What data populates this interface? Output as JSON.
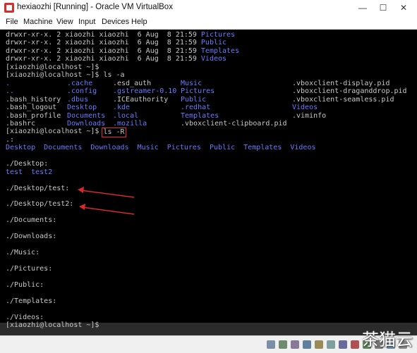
{
  "window": {
    "title": "hexiaozhi [Running] - Oracle VM VirtualBox",
    "controls": {
      "minimize": "—",
      "maximize": "☐",
      "close": "✕"
    }
  },
  "menu": [
    {
      "label": "File"
    },
    {
      "label": "Machine"
    },
    {
      "label": "View"
    },
    {
      "label": "Input"
    },
    {
      "label": "Devices"
    },
    {
      "label": "Help"
    }
  ],
  "terminal": {
    "lines": [
      {
        "cols": [
          {
            "text": "drwxr-xr-x. 2 xiaozhi xiaozhi  6 Aug  8 21:59 ",
            "color": "grey"
          },
          {
            "text": "Pictures",
            "color": "blue"
          }
        ]
      },
      {
        "cols": [
          {
            "text": "drwxr-xr-x. 2 xiaozhi xiaozhi  6 Aug  8 21:59 ",
            "color": "grey"
          },
          {
            "text": "Public",
            "color": "blue"
          }
        ]
      },
      {
        "cols": [
          {
            "text": "drwxr-xr-x. 2 xiaozhi xiaozhi  6 Aug  8 21:59 ",
            "color": "grey"
          },
          {
            "text": "Templates",
            "color": "blue"
          }
        ]
      },
      {
        "cols": [
          {
            "text": "drwxr-xr-x. 2 xiaozhi xiaozhi  6 Aug  8 21:59 ",
            "color": "grey"
          },
          {
            "text": "Videos",
            "color": "blue"
          }
        ]
      },
      {
        "cols": [
          {
            "text": "[xiaozhi@localhost ~]$",
            "color": "grey"
          }
        ]
      },
      {
        "cols": [
          {
            "text": "[xiaozhi@localhost ~]$ ls -a",
            "color": "grey"
          }
        ]
      },
      {
        "cols": [
          {
            "text": ".",
            "color": "blue",
            "col": 0
          },
          {
            "text": ".cache",
            "color": "blue",
            "col": 1
          },
          {
            "text": ".esd_auth",
            "color": "grey",
            "col": 2
          },
          {
            "text": "Music",
            "color": "blue",
            "col": 3
          },
          {
            "text": ".vboxclient-display.pid",
            "color": "grey",
            "col": 4
          }
        ]
      },
      {
        "cols": [
          {
            "text": "..",
            "color": "blue",
            "col": 0
          },
          {
            "text": ".config",
            "color": "blue",
            "col": 1
          },
          {
            "text": ".gstreamer-0.10",
            "color": "blue",
            "col": 2
          },
          {
            "text": "Pictures",
            "color": "blue",
            "col": 3
          },
          {
            "text": ".vboxclient-draganddrop.pid",
            "color": "grey",
            "col": 4
          }
        ]
      },
      {
        "cols": [
          {
            "text": ".bash_history",
            "color": "grey",
            "col": 0
          },
          {
            "text": ".dbus",
            "color": "blue",
            "col": 1
          },
          {
            "text": ".ICEauthority",
            "color": "grey",
            "col": 2
          },
          {
            "text": "Public",
            "color": "blue",
            "col": 3
          },
          {
            "text": ".vboxclient-seamless.pid",
            "color": "grey",
            "col": 4
          }
        ]
      },
      {
        "cols": [
          {
            "text": ".bash_logout",
            "color": "grey",
            "col": 0
          },
          {
            "text": "Desktop",
            "color": "blue",
            "col": 1
          },
          {
            "text": ".kde",
            "color": "blue",
            "col": 2
          },
          {
            "text": ".redhat",
            "color": "blue",
            "col": 3
          },
          {
            "text": "Videos",
            "color": "blue",
            "col": 4
          }
        ]
      },
      {
        "cols": [
          {
            "text": ".bash_profile",
            "color": "grey",
            "col": 0
          },
          {
            "text": "Documents",
            "color": "blue",
            "col": 1
          },
          {
            "text": ".local",
            "color": "blue",
            "col": 2
          },
          {
            "text": "Templates",
            "color": "blue",
            "col": 3
          },
          {
            "text": ".viminfo",
            "color": "grey",
            "col": 4
          }
        ]
      },
      {
        "cols": [
          {
            "text": ".bashrc",
            "color": "grey",
            "col": 0
          },
          {
            "text": "Downloads",
            "color": "blue",
            "col": 1
          },
          {
            "text": ".mozilla",
            "color": "blue",
            "col": 2
          },
          {
            "text": ".vboxclient-clipboard.pid",
            "color": "grey",
            "col": 3
          }
        ]
      },
      {
        "cols": [
          {
            "text": "[xiaozhi@localhost ~]$ ",
            "color": "grey"
          },
          {
            "text": "ls -R",
            "color": "grey",
            "boxed": true
          }
        ]
      },
      {
        "cols": [
          {
            "text": ".:",
            "color": "grey"
          }
        ]
      },
      {
        "cols": [
          {
            "text": "Desktop  Documents  Downloads  Music  Pictures  Public  Templates  Videos",
            "color": "blue"
          }
        ]
      },
      {
        "cols": [
          {
            "text": "",
            "color": "grey"
          }
        ]
      },
      {
        "cols": [
          {
            "text": "./Desktop:",
            "color": "grey"
          }
        ]
      },
      {
        "cols": [
          {
            "text": "test  test2",
            "color": "blue"
          }
        ]
      },
      {
        "cols": [
          {
            "text": "",
            "color": "grey"
          }
        ]
      },
      {
        "cols": [
          {
            "text": "./Desktop/test:",
            "color": "grey"
          }
        ]
      },
      {
        "cols": [
          {
            "text": "",
            "color": "grey"
          }
        ]
      },
      {
        "cols": [
          {
            "text": "./Desktop/test2:",
            "color": "grey"
          }
        ]
      },
      {
        "cols": [
          {
            "text": "",
            "color": "grey"
          }
        ]
      },
      {
        "cols": [
          {
            "text": "./Documents:",
            "color": "grey"
          }
        ]
      },
      {
        "cols": [
          {
            "text": "",
            "color": "grey"
          }
        ]
      },
      {
        "cols": [
          {
            "text": "./Downloads:",
            "color": "grey"
          }
        ]
      },
      {
        "cols": [
          {
            "text": "",
            "color": "grey"
          }
        ]
      },
      {
        "cols": [
          {
            "text": "./Music:",
            "color": "grey"
          }
        ]
      },
      {
        "cols": [
          {
            "text": "",
            "color": "grey"
          }
        ]
      },
      {
        "cols": [
          {
            "text": "./Pictures:",
            "color": "grey"
          }
        ]
      },
      {
        "cols": [
          {
            "text": "",
            "color": "grey"
          }
        ]
      },
      {
        "cols": [
          {
            "text": "./Public:",
            "color": "grey"
          }
        ]
      },
      {
        "cols": [
          {
            "text": "",
            "color": "grey"
          }
        ]
      },
      {
        "cols": [
          {
            "text": "./Templates:",
            "color": "grey"
          }
        ]
      },
      {
        "cols": [
          {
            "text": "",
            "color": "grey"
          }
        ]
      },
      {
        "cols": [
          {
            "text": "./Videos:",
            "color": "grey"
          }
        ]
      },
      {
        "cols": [
          {
            "text": "[xiaozhi@localhost ~]$",
            "color": "grey"
          }
        ]
      }
    ]
  },
  "annotations": {
    "arrow_color": "#d42a2a",
    "arrow_targets": [
      "./Desktop/test:",
      "./Desktop/test2:"
    ]
  },
  "status_icons": [
    "hard-disk-icon",
    "optical-drive-icon",
    "audio-icon",
    "network-icon",
    "usb-icon",
    "shared-folder-icon",
    "display-icon",
    "recording-icon",
    "guest-additions-icon",
    "cpu-icon",
    "mouse-integration-icon",
    "host-key-icon"
  ],
  "watermark": {
    "text": "茶猫云"
  }
}
